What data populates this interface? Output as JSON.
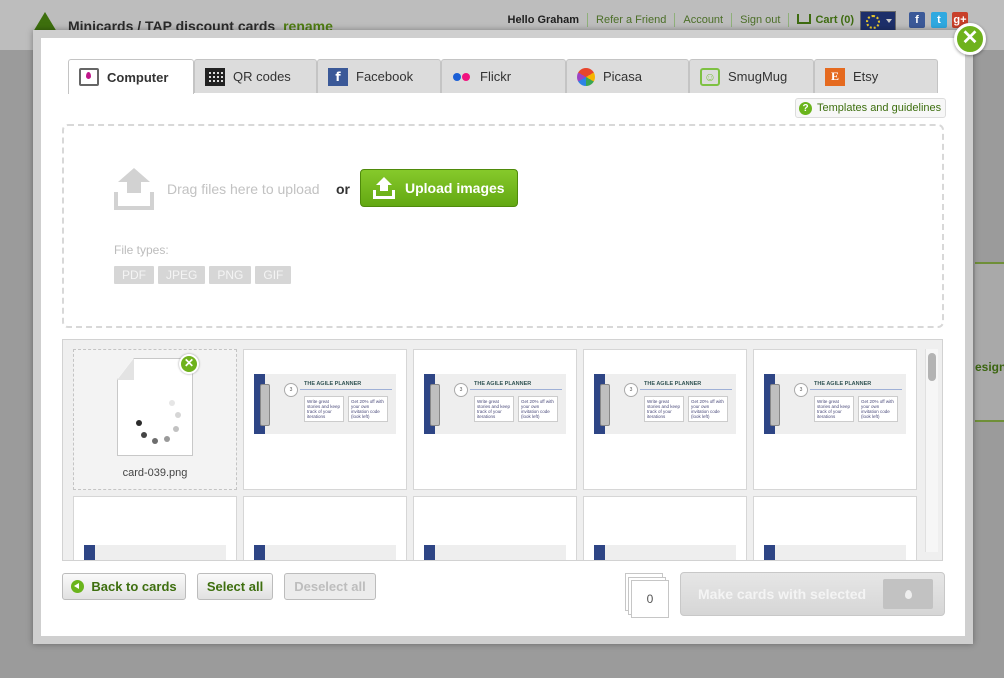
{
  "header": {
    "breadcrumb": "Minicards / TAP discount cards",
    "rename_link": "rename",
    "greeting": "Hello Graham",
    "nav": [
      "Refer a Friend",
      "Account",
      "Sign out"
    ],
    "cart": "Cart (0)",
    "social": {
      "facebook": "f",
      "twitter": "t",
      "google_plus": "g+"
    }
  },
  "background_peek": "esign",
  "tabs": [
    {
      "label": "Computer",
      "icon": "computer-icon",
      "active": true
    },
    {
      "label": "QR codes",
      "icon": "qr-code-icon"
    },
    {
      "label": "Facebook",
      "icon": "facebook-icon",
      "glyph": "f"
    },
    {
      "label": "Flickr",
      "icon": "flickr-icon"
    },
    {
      "label": "Picasa",
      "icon": "picasa-icon"
    },
    {
      "label": "SmugMug",
      "icon": "smugmug-icon",
      "glyph": "☺"
    },
    {
      "label": "Etsy",
      "icon": "etsy-icon",
      "glyph": "E"
    }
  ],
  "templates_link": {
    "icon": "?",
    "label": "Templates and guidelines"
  },
  "upload": {
    "drag_text": "Drag files here to upload",
    "or_text": "or",
    "button_label": "Upload images",
    "file_types_label": "File types:",
    "file_types": [
      "PDF",
      "JPEG",
      "PNG",
      "GIF"
    ]
  },
  "gallery": {
    "loading_item": {
      "filename": "card-039.png",
      "remove_icon": "✕"
    },
    "thumb": {
      "title": "THE AGILE PLANNER",
      "step": "3",
      "box1": "Write great stories and keep track of your iterations",
      "box2": "Get 20% off with your own invitation code (look left)"
    }
  },
  "footer": {
    "back_label": "Back to cards",
    "select_all_label": "Select all",
    "deselect_all_label": "Deselect all",
    "selected_count": "0",
    "make_cards_label": "Make cards with selected"
  },
  "colors": {
    "accent_green": "#6fb21c",
    "link_green": "#3e6f0f",
    "flickr_blue": "#1b5fd6",
    "flickr_pink": "#f0137f",
    "facebook_blue": "#3b5998",
    "etsy_orange": "#e56a1f"
  }
}
